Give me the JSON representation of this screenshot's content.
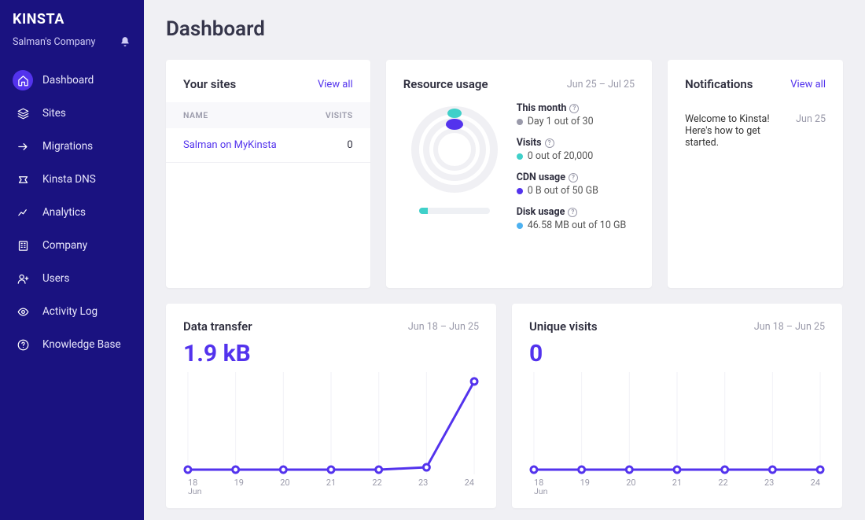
{
  "brand": "KINSTA",
  "company_name": "Salman's Company",
  "page_title": "Dashboard",
  "nav": [
    {
      "label": "Dashboard",
      "icon": "home",
      "active": true
    },
    {
      "label": "Sites",
      "icon": "layers"
    },
    {
      "label": "Migrations",
      "icon": "migrate"
    },
    {
      "label": "Kinsta DNS",
      "icon": "dns"
    },
    {
      "label": "Analytics",
      "icon": "chart"
    },
    {
      "label": "Company",
      "icon": "building"
    },
    {
      "label": "Users",
      "icon": "user-plus"
    },
    {
      "label": "Activity Log",
      "icon": "eye"
    },
    {
      "label": "Knowledge Base",
      "icon": "help"
    }
  ],
  "sites_card": {
    "title": "Your sites",
    "view_all": "View all",
    "cols": {
      "name": "NAME",
      "visits": "VISITS"
    },
    "rows": [
      {
        "name": "Salman on MyKinsta",
        "visits": "0"
      }
    ]
  },
  "resource_card": {
    "title": "Resource usage",
    "date_range": "Jun 25 – Jul 25",
    "stats": {
      "this_month": {
        "label": "This month",
        "value": "Day 1 out of 30"
      },
      "visits": {
        "label": "Visits",
        "value": "0 out of 20,000"
      },
      "cdn": {
        "label": "CDN usage",
        "value": "0 B out of 50 GB"
      },
      "disk": {
        "label": "Disk usage",
        "value": "46.58 MB out of 10 GB"
      }
    }
  },
  "notifications_card": {
    "title": "Notifications",
    "view_all": "View all",
    "items": [
      {
        "text": "Welcome to Kinsta! Here's how to get started.",
        "date": "Jun 25"
      }
    ]
  },
  "transfer_card": {
    "title": "Data transfer",
    "date_range": "Jun 18 – Jun 25",
    "metric": "1.9 kB"
  },
  "visits_card": {
    "title": "Unique visits",
    "date_range": "Jun 18 – Jun 25",
    "metric": "0"
  },
  "x_labels": [
    "18",
    "19",
    "20",
    "21",
    "22",
    "23",
    "24"
  ],
  "x_month": "Jun",
  "chart_data": [
    {
      "type": "line",
      "title": "Data transfer",
      "xlabel": "",
      "ylabel": "",
      "categories": [
        "18",
        "19",
        "20",
        "21",
        "22",
        "23",
        "24"
      ],
      "series": [
        {
          "name": "transfer",
          "values": [
            0,
            0,
            0,
            0,
            0,
            0.05,
            1.9
          ]
        }
      ],
      "ylim": [
        0,
        2
      ]
    },
    {
      "type": "line",
      "title": "Unique visits",
      "xlabel": "",
      "ylabel": "",
      "categories": [
        "18",
        "19",
        "20",
        "21",
        "22",
        "23",
        "24"
      ],
      "series": [
        {
          "name": "visits",
          "values": [
            0,
            0,
            0,
            0,
            0,
            0,
            0
          ]
        }
      ],
      "ylim": [
        0,
        1
      ]
    }
  ],
  "colors": {
    "accent": "#5333ed",
    "teal": "#3fd0c9",
    "blue": "#4db1f0",
    "gray": "#9a9aaa"
  }
}
